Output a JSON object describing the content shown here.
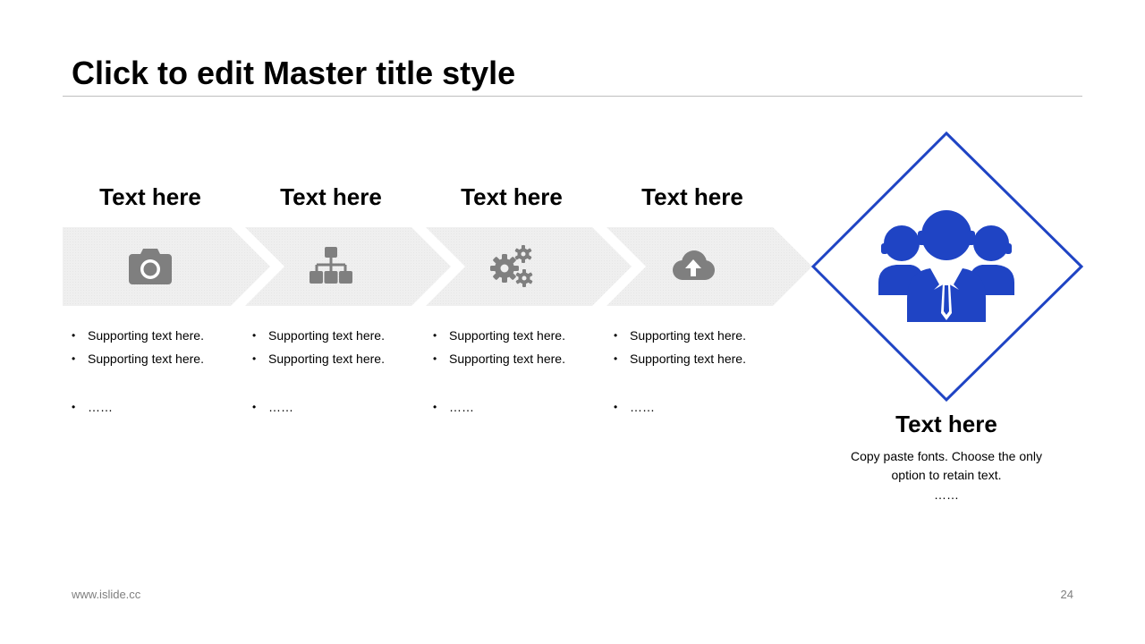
{
  "slide": {
    "title": "Click to edit Master title style",
    "footer_url": "www.islide.cc",
    "page_number": "24"
  },
  "colors": {
    "accent": "#1f44c4",
    "chevron_fill": "#efefef",
    "icon_gray": "#7f7f7f"
  },
  "steps": [
    {
      "heading": "Text here",
      "icon": "camera-icon",
      "bullets": [
        "Supporting text here.",
        "Supporting text here.",
        "……"
      ]
    },
    {
      "heading": "Text here",
      "icon": "org-chart-icon",
      "bullets": [
        "Supporting text here.",
        "Supporting text here.",
        "……"
      ]
    },
    {
      "heading": "Text here",
      "icon": "gears-icon",
      "bullets": [
        "Supporting text here.",
        "Supporting text here.",
        "……"
      ]
    },
    {
      "heading": "Text here",
      "icon": "cloud-upload-icon",
      "bullets": [
        "Supporting text here.",
        "Supporting text here.",
        "……"
      ]
    }
  ],
  "feature": {
    "icon": "team-icon",
    "heading": "Text here",
    "description": "Copy paste fonts. Choose the only option to retain text.",
    "ellipsis": "……"
  }
}
